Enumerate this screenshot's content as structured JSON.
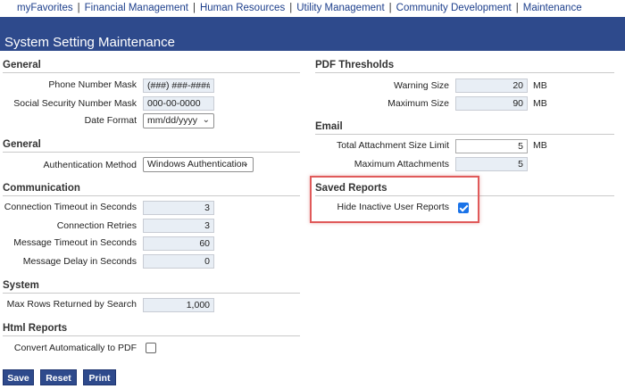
{
  "nav": {
    "items": [
      "myFavorites",
      "Financial Management",
      "Human Resources",
      "Utility Management",
      "Community Development",
      "Maintenance"
    ],
    "separator": "|"
  },
  "page": {
    "title": "System Setting Maintenance"
  },
  "colors": {
    "header_bg": "#2e4a8c",
    "field_bg": "#e8eef5",
    "highlight": "#e05a5a",
    "checkbox_on": "#1a73e8"
  },
  "general1": {
    "title": "General",
    "phone_mask": {
      "label": "Phone Number Mask",
      "value": "(###) ###-####"
    },
    "ssn_mask": {
      "label": "Social Security Number Mask",
      "value": "000-00-0000"
    },
    "date_format": {
      "label": "Date Format",
      "value": "mm/dd/yyyy"
    }
  },
  "general2": {
    "title": "General",
    "auth_method": {
      "label": "Authentication Method",
      "value": "Windows Authentication"
    }
  },
  "communication": {
    "title": "Communication",
    "connection_timeout": {
      "label": "Connection Timeout in Seconds",
      "value": "3"
    },
    "connection_retries": {
      "label": "Connection Retries",
      "value": "3"
    },
    "message_timeout": {
      "label": "Message Timeout in Seconds",
      "value": "60"
    },
    "message_delay": {
      "label": "Message Delay in Seconds",
      "value": "0"
    }
  },
  "system": {
    "title": "System",
    "max_rows": {
      "label": "Max Rows Returned by Search",
      "value": "1,000"
    }
  },
  "html_reports": {
    "title": "Html Reports",
    "convert_pdf": {
      "label": "Convert Automatically to PDF",
      "checked": false
    }
  },
  "pdf_thresholds": {
    "title": "PDF Thresholds",
    "warning_size": {
      "label": "Warning Size",
      "value": "20",
      "unit": "MB"
    },
    "maximum_size": {
      "label": "Maximum Size",
      "value": "90",
      "unit": "MB"
    }
  },
  "email": {
    "title": "Email",
    "total_attachment": {
      "label": "Total Attachment Size Limit",
      "value": "5",
      "unit": "MB"
    },
    "max_attachments": {
      "label": "Maximum Attachments",
      "value": "5"
    }
  },
  "saved_reports": {
    "title": "Saved Reports",
    "hide_inactive": {
      "label": "Hide Inactive User Reports",
      "checked": true
    }
  },
  "buttons": {
    "save": "Save",
    "reset": "Reset",
    "print": "Print"
  }
}
